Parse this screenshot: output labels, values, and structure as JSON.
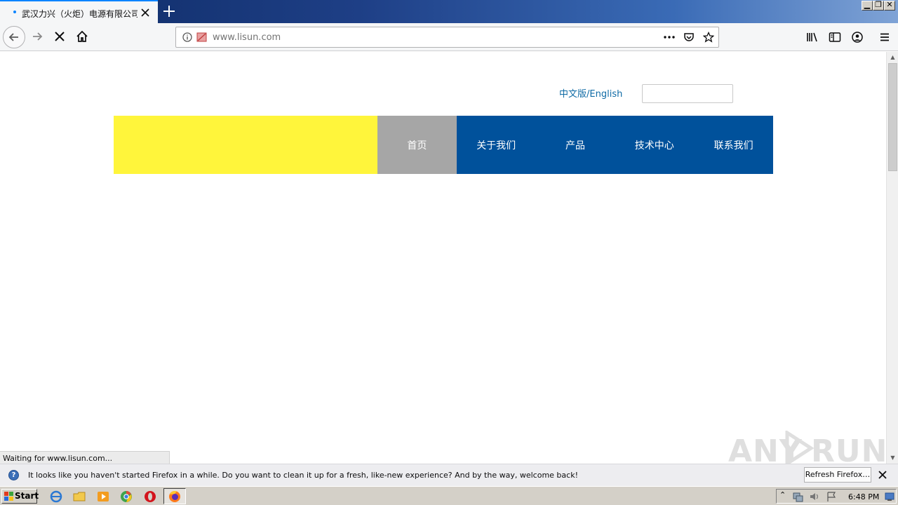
{
  "browser": {
    "tab_title": "武汉力兴（火炬）电源有限公司-力",
    "url_host": "www.lisun.com",
    "status_text": "Waiting for www.lisun.com..."
  },
  "page": {
    "lang_zh": "中文版",
    "lang_sep": "/",
    "lang_en": "English",
    "nav": [
      {
        "label": "首页",
        "active": true
      },
      {
        "label": "关于我们",
        "active": false
      },
      {
        "label": "产品",
        "active": false
      },
      {
        "label": "技术中心",
        "active": false
      },
      {
        "label": "联系我们",
        "active": false
      }
    ],
    "colors": {
      "logo_bg": "#fff53b",
      "nav_bg": "#00519b",
      "nav_active": "#a6a6a6"
    }
  },
  "notification": {
    "message": "It looks like you haven't started Firefox in a while. Do you want to clean it up for a fresh, like-new experience? And by the way, welcome back!",
    "button": "Refresh Firefox…"
  },
  "watermark": {
    "left": "ANY",
    "right": "RUN"
  },
  "taskbar": {
    "start_label": "Start",
    "clock": "6:48 PM"
  }
}
